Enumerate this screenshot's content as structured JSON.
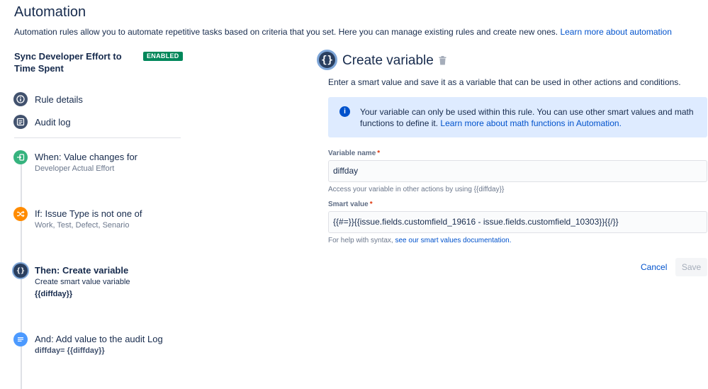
{
  "header": {
    "title": "Automation",
    "description": "Automation rules allow you to automate repetitive tasks based on criteria that you set. Here you can manage existing rules and create new ones.",
    "learn_more": "Learn more about automation"
  },
  "rule": {
    "name": "Sync Developer Effort to Time Spent",
    "status": "ENABLED",
    "status_color": "#00875a"
  },
  "nav": {
    "items": [
      {
        "label": "Rule details",
        "icon": "info-icon"
      },
      {
        "label": "Audit log",
        "icon": "list-icon"
      }
    ]
  },
  "steps": {
    "trigger": {
      "title": "When: Value changes for",
      "sub": "Developer Actual Effort",
      "icon": "trigger-icon",
      "color": "#36b37e"
    },
    "condition": {
      "title": "If: Issue Type is not one of",
      "sub": "Work, Test, Defect, Senario",
      "icon": "shuffle-icon",
      "color": "#ff8b00"
    },
    "action1": {
      "title": "Then: Create variable",
      "sub": "Create smart value variable",
      "sub2": "{{diffday}}",
      "icon": "braces-icon",
      "color": "#2a3f5f"
    },
    "action2": {
      "title": "And: Add value to the audit Log",
      "sub": "diffday= {{diffday}}",
      "icon": "log-icon",
      "color": "#4c9aff"
    }
  },
  "panel": {
    "title": "Create variable",
    "icon_text": "{}",
    "description": "Enter a smart value and save it as a variable that can be used in other actions and conditions.",
    "info": {
      "text": "Your variable can only be used within this rule. You can use other smart values and math functions to define it.",
      "link": "Learn more about math functions in Automation."
    },
    "variable_name": {
      "label": "Variable name",
      "required": "*",
      "value": "diffday",
      "help": "Access your variable in other actions by using {{diffday}}"
    },
    "smart_value": {
      "label": "Smart value",
      "required": "*",
      "value": "{{#=}}{{issue.fields.customfield_19616 - issue.fields.customfield_10303}}{{/}}",
      "help_prefix": "For help with syntax,",
      "help_link": "see our smart values documentation."
    },
    "cancel_label": "Cancel",
    "save_label": "Save"
  }
}
